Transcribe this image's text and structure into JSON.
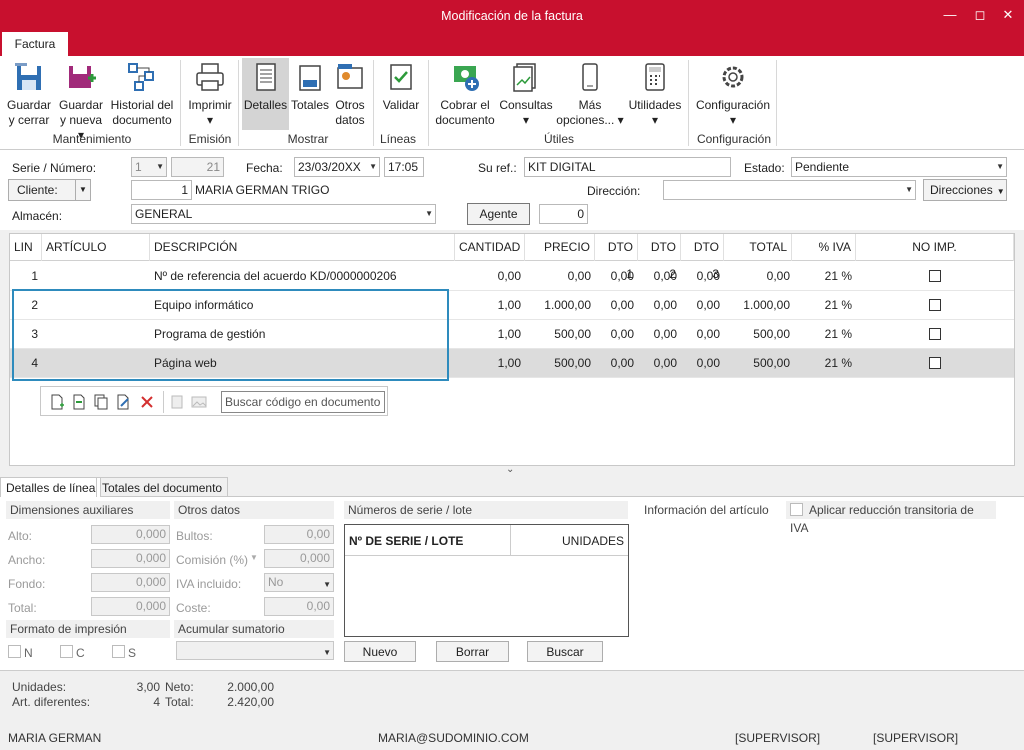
{
  "window": {
    "title": "Modificación de la factura"
  },
  "ribbon_tab": "Factura",
  "ribbon": {
    "buttons": [
      {
        "id": "guardar_cerrar",
        "l1": "Guardar",
        "l2": "y cerrar"
      },
      {
        "id": "guardar_nueva",
        "l1": "Guardar",
        "l2": "y nueva ▾"
      },
      {
        "id": "historial",
        "l1": "Historial del",
        "l2": "documento"
      },
      {
        "id": "imprimir",
        "l1": "Imprimir",
        "l2": "▾"
      },
      {
        "id": "detalles",
        "l1": "Detalles",
        "l2": ""
      },
      {
        "id": "totales",
        "l1": "Totales",
        "l2": ""
      },
      {
        "id": "otros",
        "l1": "Otros",
        "l2": "datos"
      },
      {
        "id": "validar",
        "l1": "Validar",
        "l2": ""
      },
      {
        "id": "cobrar",
        "l1": "Cobrar el",
        "l2": "documento"
      },
      {
        "id": "consultas",
        "l1": "Consultas",
        "l2": "▾"
      },
      {
        "id": "mas",
        "l1": "Más",
        "l2": "opciones... ▾"
      },
      {
        "id": "utilidades",
        "l1": "Utilidades",
        "l2": "▾"
      },
      {
        "id": "configuracion",
        "l1": "Configuración",
        "l2": "▾"
      }
    ],
    "groups": [
      "Mantenimiento",
      "Emisión",
      "Mostrar",
      "Líneas",
      "Útiles",
      "Configuración"
    ]
  },
  "form": {
    "serie_label": "Serie / Número:",
    "serie": "1",
    "numero": "21",
    "fecha_label": "Fecha:",
    "fecha": "23/03/20XX",
    "hora": "17:05",
    "suref_label": "Su ref.:",
    "suref": "KIT DIGITAL",
    "estado_label": "Estado:",
    "estado": "Pendiente",
    "cliente_btn": "Cliente:",
    "cliente_code": "1",
    "cliente_name": "MARIA GERMAN TRIGO",
    "direccion_label": "Dirección:",
    "direccion": "",
    "direcciones_btn": "Direcciones",
    "almacen_label": "Almacén:",
    "almacen": "GENERAL",
    "agente_btn": "Agente",
    "agente": "0"
  },
  "grid": {
    "columns": [
      "LIN",
      "ARTÍCULO",
      "DESCRIPCIÓN",
      "CANTIDAD",
      "PRECIO",
      "DTO 1",
      "DTO 2",
      "DTO 3",
      "TOTAL",
      "% IVA",
      "NO IMP."
    ],
    "rows": [
      {
        "lin": "1",
        "articulo": "",
        "descripcion": "Nº de referencia del acuerdo KD/0000000206",
        "cantidad": "0,00",
        "precio": "0,00",
        "dto1": "0,00",
        "dto2": "0,00",
        "dto3": "0,00",
        "total": "0,00",
        "iva": "21 %"
      },
      {
        "lin": "2",
        "articulo": "",
        "descripcion": "Equipo informático",
        "cantidad": "1,00",
        "precio": "1.000,00",
        "dto1": "0,00",
        "dto2": "0,00",
        "dto3": "0,00",
        "total": "1.000,00",
        "iva": "21 %"
      },
      {
        "lin": "3",
        "articulo": "",
        "descripcion": "Programa de gestión",
        "cantidad": "1,00",
        "precio": "500,00",
        "dto1": "0,00",
        "dto2": "0,00",
        "dto3": "0,00",
        "total": "500,00",
        "iva": "21 %"
      },
      {
        "lin": "4",
        "articulo": "",
        "descripcion": "Página web",
        "cantidad": "1,00",
        "precio": "500,00",
        "dto1": "0,00",
        "dto2": "0,00",
        "dto3": "0,00",
        "total": "500,00",
        "iva": "21 %"
      }
    ],
    "search_placeholder": "Buscar código en documento"
  },
  "bottom_tabs": [
    "Detalles de línea",
    "Totales del documento"
  ],
  "detalles": {
    "dim_header": "Dimensiones auxiliares",
    "alto_label": "Alto:",
    "alto": "0,000",
    "ancho_label": "Ancho:",
    "ancho": "0,000",
    "fondo_label": "Fondo:",
    "fondo": "0,000",
    "total_label": "Total:",
    "total": "0,000",
    "otros_header": "Otros datos",
    "bultos_label": "Bultos:",
    "bultos": "0,00",
    "comision_label": "Comisión (%)",
    "comision": "0,000",
    "iva_incl_label": "IVA incluido:",
    "iva_incl": "No",
    "coste_label": "Coste:",
    "coste": "0,00",
    "formato_header": "Formato de impresión",
    "fmt_n": "N",
    "fmt_c": "C",
    "fmt_s": "S",
    "acumular_header": "Acumular sumatorio",
    "series_header": "Números de serie / lote",
    "series_col1": "Nº DE SERIE / LOTE",
    "series_col2": "UNIDADES",
    "btn_nuevo": "Nuevo",
    "btn_borrar": "Borrar",
    "btn_buscar": "Buscar",
    "info_header": "Información del artículo",
    "reduccion": "Aplicar reducción transitoria de IVA"
  },
  "summary": {
    "unidades_label": "Unidades:",
    "unidades": "3,00",
    "art_label": "Art. diferentes:",
    "art": "4",
    "neto_label": "Neto:",
    "neto": "2.000,00",
    "total_label": "Total:",
    "total": "2.420,00"
  },
  "status": {
    "user": "MARIA GERMAN",
    "email": "MARIA@SUDOMINIO.COM",
    "role1": "[SUPERVISOR]",
    "role2": "[SUPERVISOR]"
  }
}
